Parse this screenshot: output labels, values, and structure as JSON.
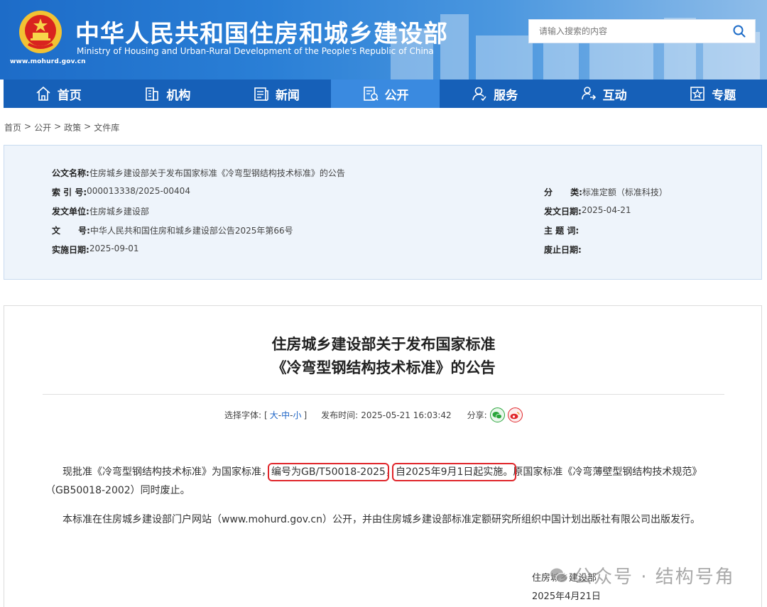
{
  "header": {
    "title_cn": "中华人民共和国住房和城乡建设部",
    "title_en": "Ministry of Housing and Urban-Rural Development of the People's Republic of China",
    "site_url": "www.mohurd.gov.cn",
    "search_placeholder": "请输入搜索的内容"
  },
  "nav": [
    {
      "label": "首页",
      "icon": "home-icon"
    },
    {
      "label": "机构",
      "icon": "building-icon"
    },
    {
      "label": "新闻",
      "icon": "news-icon"
    },
    {
      "label": "公开",
      "icon": "disclosure-icon",
      "active": true
    },
    {
      "label": "服务",
      "icon": "service-icon"
    },
    {
      "label": "互动",
      "icon": "interact-icon"
    },
    {
      "label": "专题",
      "icon": "topic-star-icon"
    }
  ],
  "breadcrumb": [
    "首页",
    "公开",
    "政策",
    "文件库"
  ],
  "info": {
    "doc_name_label": "公文名称:",
    "doc_name": "住房城乡建设部关于发布国家标准《冷弯型钢结构技术标准》的公告",
    "index_label": "索 引 号:",
    "index": "000013338/2025-00404",
    "issuer_label": "发文单位:",
    "issuer": "住房城乡建设部",
    "doc_no_label": "文      号:",
    "doc_no": "中华人民共和国住房和城乡建设部公告2025年第66号",
    "effective_label": "实施日期:",
    "effective": "2025-09-01",
    "category_label": "分      类:",
    "category": "标准定额（标准科技）",
    "issue_date_label": "发文日期:",
    "issue_date": "2025-04-21",
    "topic_label": "主 题 词:",
    "topic": "",
    "repeal_label": "废止日期:",
    "repeal": ""
  },
  "article": {
    "title_line1": "住房城乡建设部关于发布国家标准",
    "title_line2": "《冷弯型钢结构技术标准》的公告",
    "font_label": "选择字体:",
    "font_open": "[",
    "font_large": "大",
    "font_mid": "中",
    "font_small": "小",
    "font_sep": "-",
    "font_close": "]",
    "publish_label": "发布时间:",
    "publish_time": "2025-05-21 16:03:42",
    "share_label": "分享:",
    "p1_a": "现批准《冷弯型钢结构技术标准》为国家标准，",
    "p1_hl1": "编号为GB/T50018-2025",
    "p1_sep": "，",
    "p1_hl2": "自2025年9月1日起实施。",
    "p1_b": "原国家标准《冷弯薄壁型钢结构技术规范》",
    "p1_c": "（GB50018-2002）同时废止。",
    "p2": "本标准在住房城乡建设部门户网站（www.mohurd.gov.cn）公开，并由住房城乡建设部标准定额研究所组织中国计划出版社有限公司出版发行。",
    "sign_org": "住房城乡建设部",
    "sign_date": "2025年4月21日"
  },
  "watermark": "公众号 · 结构号角",
  "colors": {
    "header_blue": "#1d6cc8",
    "nav_blue": "#1660b8",
    "nav_active": "#3a8ae0",
    "highlight_red": "#e0262b",
    "link_blue": "#1b63c6"
  }
}
